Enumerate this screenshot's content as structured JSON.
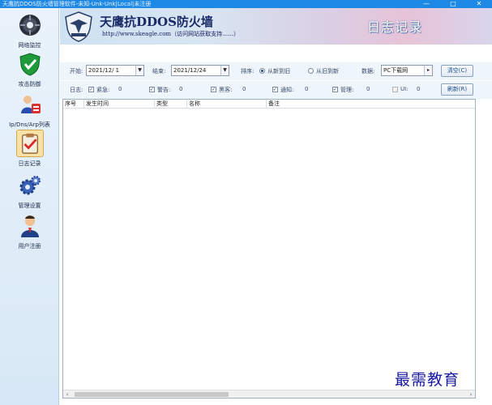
{
  "window": {
    "title": "天鹰抗DDOS防火墙管理软件-未知-Unk-Unk|Local|未注册",
    "min": "—",
    "max": "□",
    "close": "✕"
  },
  "sidebar": {
    "items": [
      {
        "label": "网络监控",
        "icon": "globe-icon"
      },
      {
        "label": "攻击防御",
        "icon": "shield-icon"
      },
      {
        "label": "Ip/Dns/Arp列表",
        "icon": "network-list-icon"
      },
      {
        "label": "日志记录",
        "icon": "clipboard-icon"
      },
      {
        "label": "管理设置",
        "icon": "gear-icon"
      },
      {
        "label": "用户注册",
        "icon": "user-icon"
      }
    ],
    "active_index": 3
  },
  "banner": {
    "title": "天鹰抗DDOS防火墙",
    "subtitle": "http://www.skeagle.com（访问网站获取支持……）",
    "section": "日志记录"
  },
  "filters": {
    "start_label": "开始:",
    "start_value": "2021/12/ 1",
    "end_label": "结束:",
    "end_value": "2021/12/24",
    "sort_label": "排序:",
    "sort_new_to_old": "从新到旧",
    "sort_old_to_new": "从旧到新",
    "sort_selected": "new_to_old",
    "data_label": "数据:",
    "data_value": "PC下载网",
    "clear_button": "清空(C)",
    "refresh_button": "刷新(R)",
    "log_label": "日志:",
    "categories": [
      {
        "label": "紧急:",
        "count": "0",
        "checked": true
      },
      {
        "label": "警告:",
        "count": "0",
        "checked": true
      },
      {
        "label": "黑客:",
        "count": "0",
        "checked": true
      },
      {
        "label": "通知:",
        "count": "0",
        "checked": true
      },
      {
        "label": "管理:",
        "count": "0",
        "checked": true
      },
      {
        "label": "UI:",
        "count": "0",
        "checked": false
      }
    ]
  },
  "table": {
    "columns": [
      "序号",
      "发生时间",
      "类型",
      "名称",
      "备注"
    ],
    "rows": []
  },
  "watermark": "最需教育",
  "colors": {
    "titlebar": "#1e88e5",
    "sidebar": "#d7e8f6",
    "active_item": "#f8e2a8",
    "accent_text": "#1a4d8a"
  }
}
